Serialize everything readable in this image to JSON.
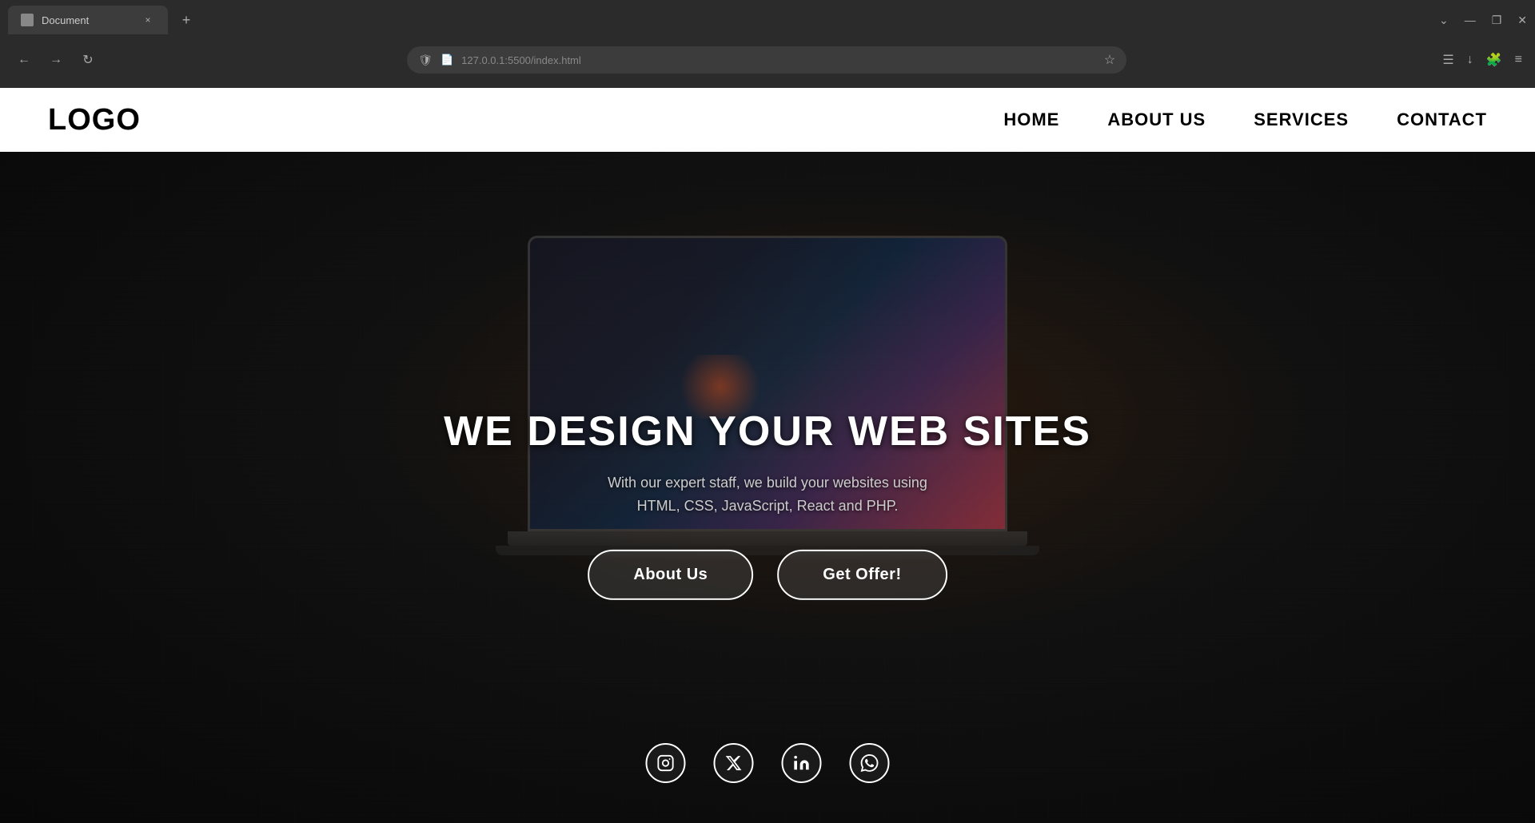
{
  "browser": {
    "tab": {
      "favicon": "document-icon",
      "title": "Document",
      "close_label": "×"
    },
    "new_tab_label": "+",
    "titlebar_controls": {
      "chevron_down": "⌄",
      "minimize": "—",
      "restore": "❐",
      "close": "✕"
    },
    "toolbar": {
      "back": "←",
      "forward": "→",
      "refresh": "↻",
      "shield_icon": "🛡",
      "page_icon": "📄",
      "url": "127.0.0.1:",
      "url_port": "5500",
      "url_path": "/index.html",
      "star_icon": "☆",
      "toolbar_icons": [
        "☰",
        "↓",
        "🧩",
        "≡"
      ]
    }
  },
  "website": {
    "navbar": {
      "logo": "LOGO",
      "links": [
        "HOME",
        "ABOUT US",
        "SERVICES",
        "CONTACT"
      ]
    },
    "hero": {
      "title": "WE DESIGN YOUR WEB SITES",
      "subtitle_line1": "With our expert staff, we build your websites using",
      "subtitle_line2": "HTML, CSS, JavaScript, React and PHP.",
      "btn_about": "About Us",
      "btn_offer": "Get Offer!"
    },
    "social": {
      "instagram_icon": "instagram-icon",
      "x_icon": "x-twitter-icon",
      "linkedin_icon": "linkedin-icon",
      "whatsapp_icon": "whatsapp-icon"
    }
  }
}
